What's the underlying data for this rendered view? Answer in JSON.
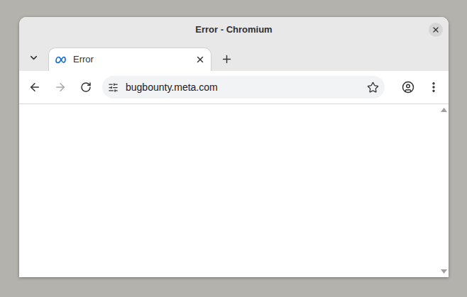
{
  "window": {
    "title": "Error - Chromium"
  },
  "tabs": [
    {
      "label": "Error",
      "selected": true
    }
  ],
  "toolbar": {
    "back_disabled": false,
    "forward_disabled": true,
    "reload_disabled": false
  },
  "address_bar": {
    "url": "bugbounty.meta.com",
    "bookmarked": false
  }
}
